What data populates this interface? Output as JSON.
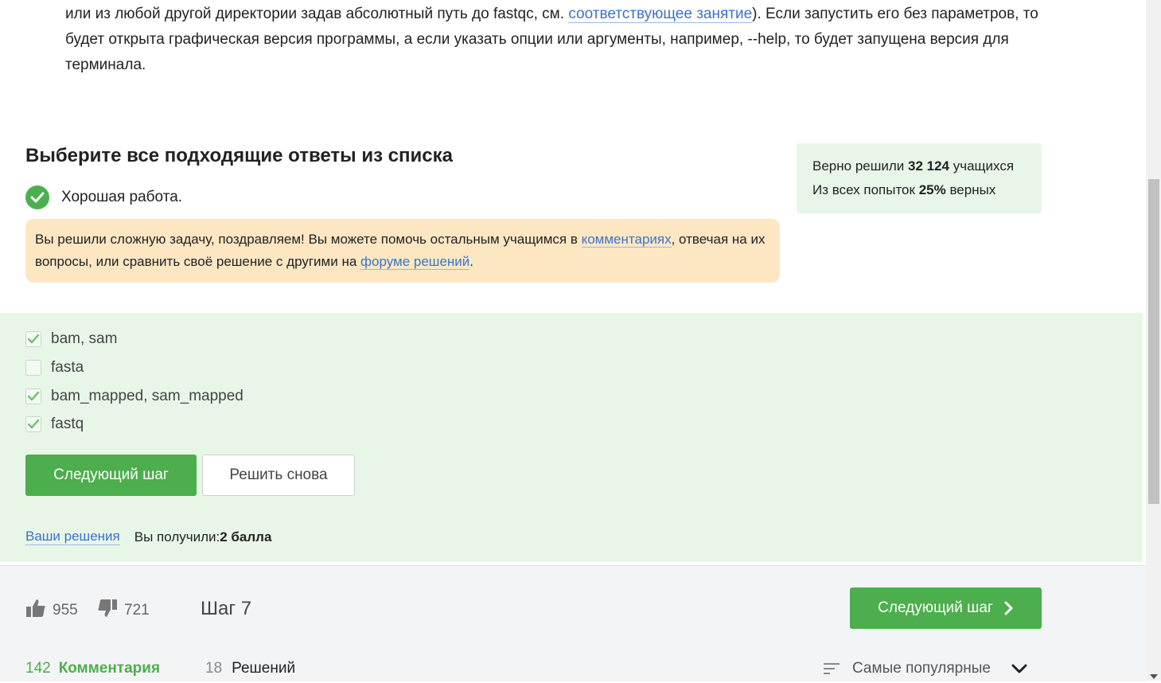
{
  "intro": {
    "text_before": "или из любой другой директории задав абсолютный путь до fastqc, см. ",
    "link": "соответствующее занятие",
    "text_after": "). Если запустить его без параметров, то будет открыта графическая версия программы, а если указать опции или аргументы, например, --help, то будет запущена версия для терминала."
  },
  "question": {
    "title": "Выберите все подходящие ответы из списка",
    "result_text": "Хорошая работа."
  },
  "hint": {
    "part1": "Вы решили сложную задачу, поздравляем! Вы можете помочь остальным учащимся в ",
    "link1": "комментариях",
    "part2": ", отвечая на их вопросы, или сравнить своё решение с другими на ",
    "link2": "форуме решений",
    "part3": "."
  },
  "stats": {
    "line1_prefix": "Верно решили ",
    "solved_count": "32 124",
    "line1_suffix": " учащихся",
    "line2_prefix": "Из всех попыток ",
    "percent": "25%",
    "line2_suffix": " верных"
  },
  "options": [
    {
      "label": "bam, sam",
      "checked": true
    },
    {
      "label": "fasta",
      "checked": false
    },
    {
      "label": "bam_mapped, sam_mapped",
      "checked": true
    },
    {
      "label": "fastq",
      "checked": true
    }
  ],
  "buttons": {
    "next_step": "Следующий шаг",
    "retry": "Решить снова"
  },
  "footer": {
    "your_solutions": "Ваши решения",
    "score_prefix": "Вы получили: ",
    "score_value": "2 балла"
  },
  "bottom": {
    "likes": "955",
    "dislikes": "721",
    "step": "Шаг 7",
    "next_button": "Следующий шаг",
    "comments_count": "142",
    "comments_label": "Комментария",
    "solutions_count": "18",
    "solutions_label": "Решений",
    "sort_label": "Самые популярные"
  },
  "colors": {
    "accent_green": "#4cae4c",
    "success_bg": "#e8f6e8",
    "hint_bg": "#fde7c3",
    "link_blue": "#3b73c9"
  }
}
